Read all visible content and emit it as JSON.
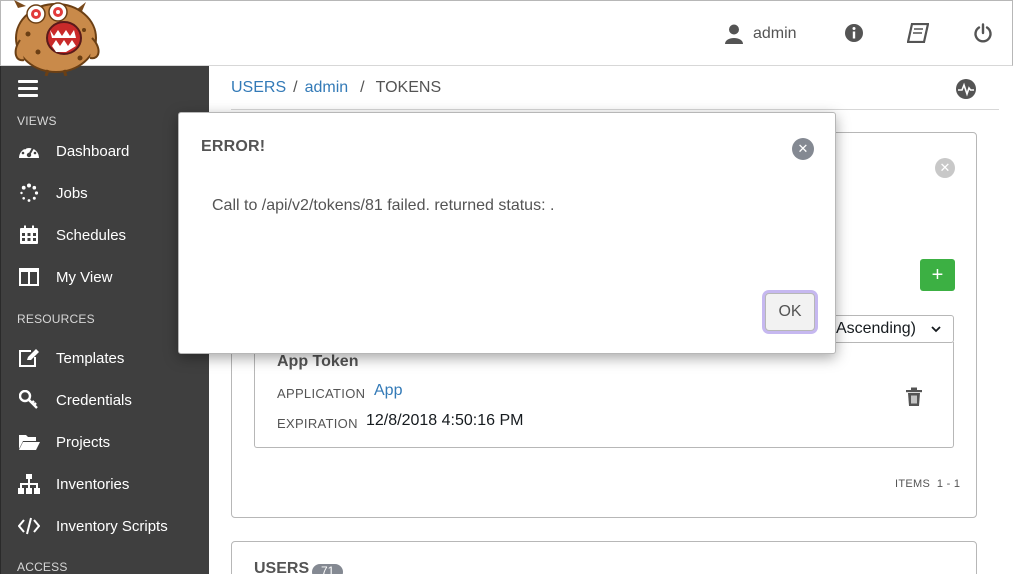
{
  "header": {
    "user_name": "admin"
  },
  "sidebar": {
    "section_views": "VIEWS",
    "section_resources": "RESOURCES",
    "section_access": "ACCESS",
    "views": [
      {
        "label": "Dashboard",
        "icon": "dashboard-icon"
      },
      {
        "label": "Jobs",
        "icon": "jobs-spinner-icon"
      },
      {
        "label": "Schedules",
        "icon": "calendar-icon"
      },
      {
        "label": "My View",
        "icon": "columns-icon"
      }
    ],
    "resources": [
      {
        "label": "Templates",
        "icon": "pencil-square-icon"
      },
      {
        "label": "Credentials",
        "icon": "key-icon"
      },
      {
        "label": "Projects",
        "icon": "folder-open-icon"
      },
      {
        "label": "Inventories",
        "icon": "sitemap-icon"
      },
      {
        "label": "Inventory Scripts",
        "icon": "code-icon"
      }
    ]
  },
  "breadcrumb": {
    "users": "USERS",
    "sep1": "/",
    "admin": "admin",
    "sep2": "/",
    "tokens": "TOKENS"
  },
  "tokens_panel": {
    "add_label": "+",
    "sort_value": "(Ascending)",
    "token": {
      "name": "App Token",
      "application_key": "APPLICATION",
      "application_value": "App",
      "expiration_key": "EXPIRATION",
      "expiration_value": "12/8/2018 4:50:16 PM"
    },
    "items_label": "ITEMS",
    "items_range": "1 - 1"
  },
  "users_panel": {
    "label": "USERS",
    "count": "71"
  },
  "modal": {
    "title": "ERROR!",
    "message": "Call to /api/v2/tokens/81 failed. returned status: .",
    "ok_label": "OK"
  },
  "colors": {
    "sidebar_bg": "#3f3f3f",
    "link": "#337ab7",
    "add_button": "#3cb043",
    "ok_focus_ring": "#c6b8f0"
  }
}
